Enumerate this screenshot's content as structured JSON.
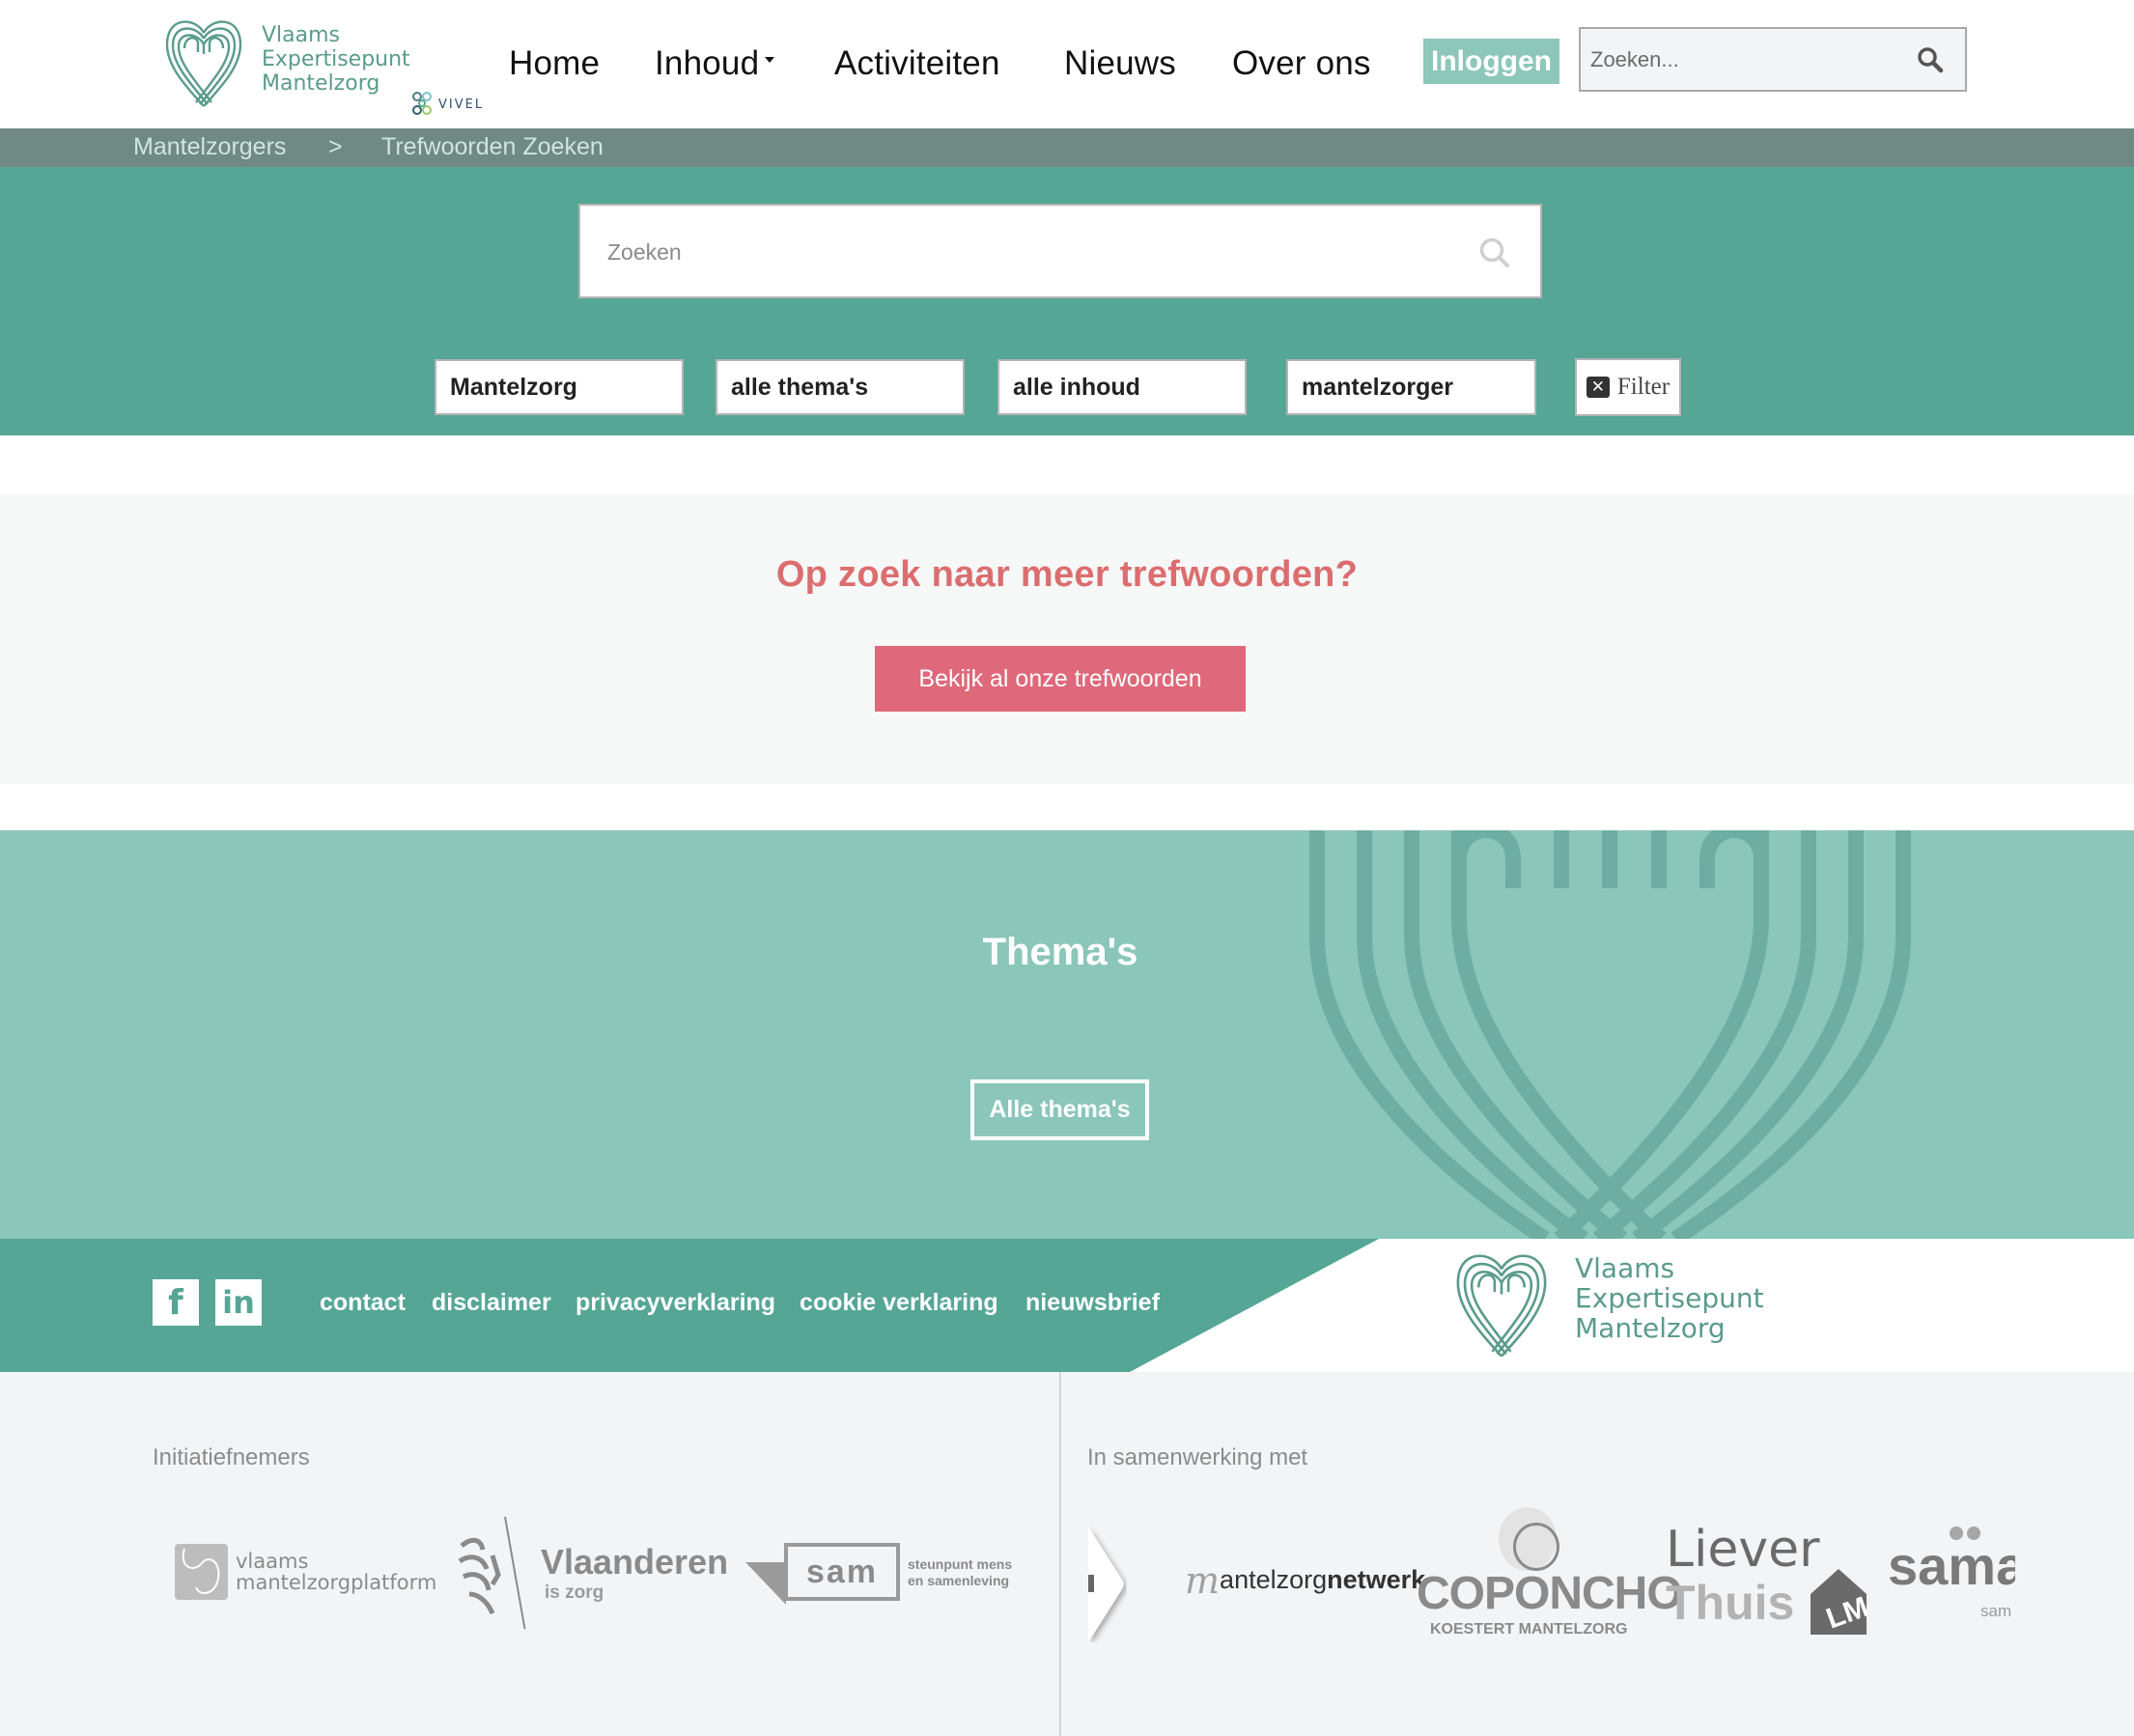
{
  "header": {
    "logo": {
      "line1": "Vlaams",
      "line2": "Expertisepunt",
      "line3": "Mantelzorg",
      "partner": "VIVEL"
    },
    "nav": [
      {
        "label": "Home",
        "has_dropdown": false
      },
      {
        "label": "Inhoud",
        "has_dropdown": true
      },
      {
        "label": "Activiteiten",
        "has_dropdown": false
      },
      {
        "label": "Nieuws",
        "has_dropdown": false
      },
      {
        "label": "Over ons",
        "has_dropdown": false
      }
    ],
    "login_label": "Inloggen",
    "search": {
      "placeholder": "Zoeken...",
      "value": "",
      "icon": "search-icon"
    }
  },
  "breadcrumb": {
    "items": [
      "Mantelzorgers",
      "Trefwoorden Zoeken"
    ],
    "separator": ">"
  },
  "search_section": {
    "search": {
      "placeholder": "Zoeken",
      "value": "",
      "icon": "search-icon"
    },
    "filters": [
      {
        "name": "doelgroep",
        "selected": "Mantelzorg"
      },
      {
        "name": "thema",
        "selected": "alle thema's"
      },
      {
        "name": "inhoud",
        "selected": "alle inhoud"
      },
      {
        "name": "trefwoord",
        "selected": "mantelzorger"
      }
    ],
    "reset_filter_label": "Filter",
    "reset_filter_icon": "close-box-icon"
  },
  "cta": {
    "title": "Op zoek naar meer trefwoorden?",
    "button_label": "Bekijk al onze trefwoorden"
  },
  "themas": {
    "title": "Thema's",
    "button_label": "Alle thema's"
  },
  "footer": {
    "social": [
      {
        "name": "facebook",
        "glyph": "f"
      },
      {
        "name": "linkedin",
        "glyph": "in"
      }
    ],
    "links": [
      "contact",
      "disclaimer",
      "privacyverklaring",
      "cookie verklaring",
      "nieuwsbrief"
    ],
    "logo": {
      "line1": "Vlaams",
      "line2": "Expertisepunt",
      "line3": "Mantelzorg"
    }
  },
  "partners": {
    "initiators_label": "Initiatiefnemers",
    "initiators": [
      {
        "line1": "vlaams",
        "line2": "mantelzorgplatform"
      },
      {
        "line1": "Vlaanderen",
        "line2": "is zorg"
      },
      {
        "line1": "sam",
        "line2": "steunpunt mens",
        "line3": "en samenleving"
      }
    ],
    "collaborators_label": "In samenwerking met",
    "collaborators": [
      {
        "part1": "antelzorg",
        "part2": "netwerk",
        "prefix": "m"
      },
      {
        "line1": "COPONCHO",
        "line2": "KOESTERT MANTELZORG"
      },
      {
        "line1": "Liever",
        "line2": "Thuis",
        "badge": "LM"
      },
      {
        "line1": "sama",
        "line2": "sam"
      }
    ]
  },
  "colors": {
    "brand_green": "#55a695",
    "light_green": "#8ac6b9",
    "breadcrumb_grey": "#6f8a83",
    "accent_red": "#df687a",
    "heading_red": "#dc6d6f",
    "logo_green": "#5a9b8c"
  }
}
